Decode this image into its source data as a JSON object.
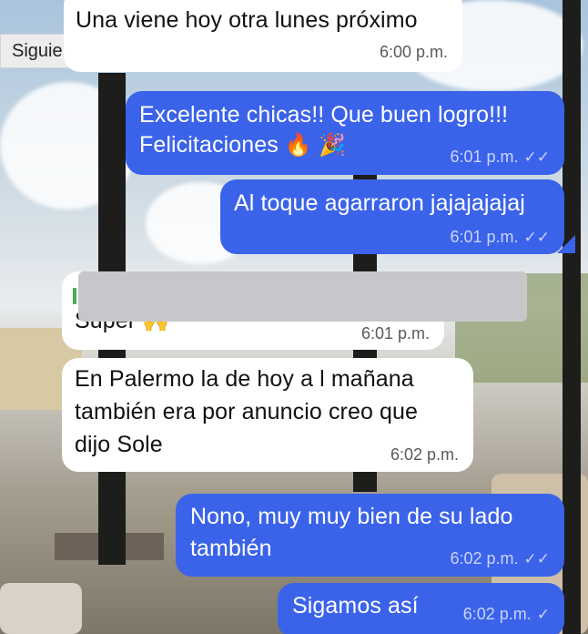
{
  "nav": {
    "next_label": "Siguiente"
  },
  "messages": [
    {
      "dir": "in",
      "text": "Una viene hoy otra lunes próximo",
      "time": "6:00 p.m."
    },
    {
      "dir": "out",
      "lines": [
        "Excelente chicas!! Que buen logro!!!",
        "Felicitaciones"
      ],
      "emojis": [
        "🔥",
        "🎉"
      ],
      "time": "6:01 p.m.",
      "status": "read"
    },
    {
      "dir": "out",
      "text": "Al toque agarraron jajajajajaj",
      "time": "6:01 p.m.",
      "status": "read"
    },
    {
      "dir": "in",
      "text": "Super",
      "emoji": "🙌",
      "time": "6:01 p.m."
    },
    {
      "dir": "in",
      "lines": [
        "En Palermo la de hoy a l mañana",
        "también era por anuncio creo que",
        "dijo Sole"
      ],
      "time": "6:02 p.m."
    },
    {
      "dir": "out",
      "lines": [
        "Nono, muy muy bien de su lado",
        "también"
      ],
      "time": "6:02 p.m.",
      "status": "read"
    },
    {
      "dir": "out",
      "text": "Sigamos así",
      "time": "6:02 p.m.",
      "status": "sent"
    }
  ],
  "icons": {
    "double_check": "✓✓",
    "single_check": "✓"
  },
  "colors": {
    "outgoing": "#3b63ea",
    "incoming": "#ffffff",
    "redaction": "#c7c7cb"
  }
}
